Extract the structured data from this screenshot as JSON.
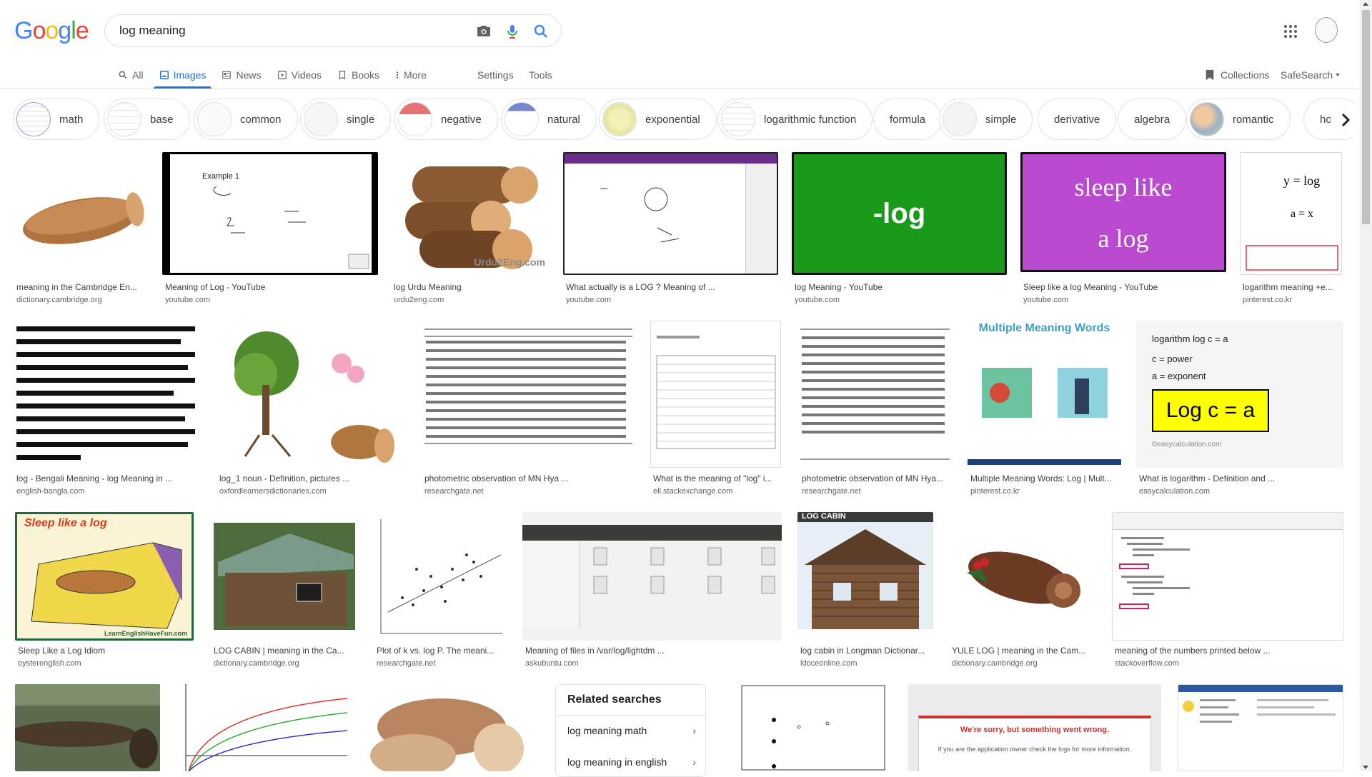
{
  "search": {
    "query": "log meaning"
  },
  "logo": "Google",
  "tabs": [
    {
      "label": "All"
    },
    {
      "label": "Images"
    },
    {
      "label": "News"
    },
    {
      "label": "Videos"
    },
    {
      "label": "Books"
    },
    {
      "label": "More"
    }
  ],
  "settings_label": "Settings",
  "tools_label": "Tools",
  "collections_label": "Collections",
  "safesearch_label": "SafeSearch",
  "chips": [
    "math",
    "base",
    "common",
    "single",
    "negative",
    "natural",
    "exponential",
    "logarithmic function",
    "formula",
    "simple",
    "derivative",
    "algebra",
    "romantic",
    "home"
  ],
  "results": [
    {
      "title": "meaning in the Cambridge En...",
      "source": "dictionary.cambridge.org"
    },
    {
      "title": "Meaning of Log - YouTube",
      "source": "youtube.com"
    },
    {
      "title": "log Urdu Meaning",
      "source": "urdu2eng.com"
    },
    {
      "title": "What actually is a LOG ? Meaning of ...",
      "source": "youtube.com"
    },
    {
      "title": "log Meaning - YouTube",
      "source": "youtube.com"
    },
    {
      "title": "Sleep like a log Meaning - YouTube",
      "source": "youtube.com"
    },
    {
      "title": "logarithm meaning +e...",
      "source": "pinterest.co.kr"
    },
    {
      "title": "log - Bengali Meaning - log Meaning in ...",
      "source": "english-bangla.com"
    },
    {
      "title": "log_1 noun - Definition, pictures ...",
      "source": "oxfordlearnersdictionaries.com"
    },
    {
      "title": "photometric observation of MN Hya ...",
      "source": "researchgate.net"
    },
    {
      "title": "What is the meaning of \"log\" i...",
      "source": "ell.stackexchange.com"
    },
    {
      "title": "photometric observation of MN Hya...",
      "source": "researchgate.net"
    },
    {
      "title": "Multiple Meaning Words: Log | Mult...",
      "source": "pinterest.co.kr"
    },
    {
      "title": "What is logarithm - Definition and ...",
      "source": "easycalculation.com"
    },
    {
      "title": "Sleep Like a Log Idiom",
      "source": "oysterenglish.com"
    },
    {
      "title": "LOG CABIN | meaning in the Ca...",
      "source": "dictionary.cambridge.org"
    },
    {
      "title": "Plot of k vs. log P. The meani...",
      "source": "researchgate.net"
    },
    {
      "title": "Meaning of files in /var/log/lightdm ...",
      "source": "askubuntu.com"
    },
    {
      "title": "log cabin in Longman Dictionar...",
      "source": "ldoceonline.com"
    },
    {
      "title": "YULE LOG | meaning in the Cam...",
      "source": "dictionary.cambridge.org"
    },
    {
      "title": "meaning of the numbers printed below ...",
      "source": "stackoverflow.com"
    }
  ],
  "thumb_text": {
    "log_urdu_watermark": "Urdu2Eng.com",
    "youtube_green": "-log",
    "sleep_like_1": "sleep like",
    "sleep_like_2": "a log",
    "example": "Example 1",
    "easycalc_1": "logarithm log c = a",
    "easycalc_2": "c = power",
    "easycalc_3": "a = exponent",
    "easycalc_box": "Log c = a",
    "easycalc_credit": "©easycalculation.com",
    "mmw_title": "Multiple Meaning Words",
    "sleep_cartoon": "Sleep like a log",
    "sleep_cartoon_credit": "LearnEnglishHaveFun.com",
    "cabin_sign": "LOG CABIN",
    "error_title": "We're sorry, but something went wrong.",
    "error_body": "If you are the application owner check the logs for more information."
  },
  "related": {
    "title": "Related searches",
    "items": [
      "log meaning math",
      "log meaning in english"
    ]
  },
  "colors": {
    "accent": "#1a73e8",
    "youtube_green": "#1a9a1a",
    "sleep_purple": "#b94ad0",
    "easycalc_yellow": "#ffff00",
    "error_red": "#c9302c"
  }
}
